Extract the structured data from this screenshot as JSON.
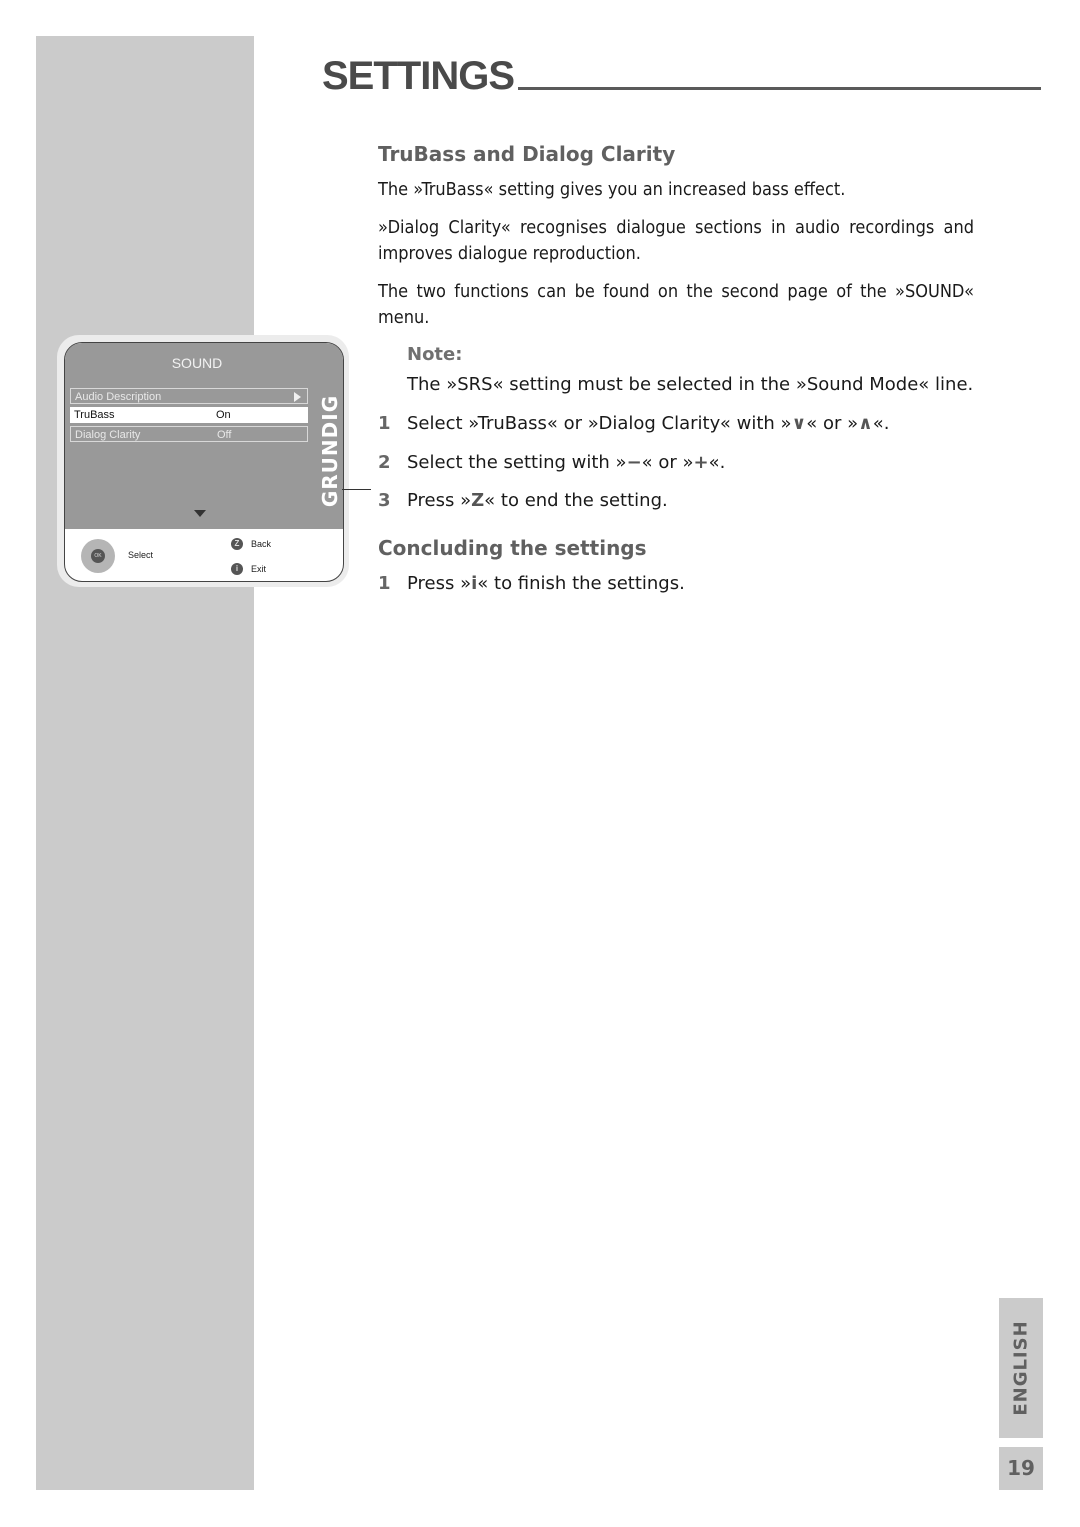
{
  "header": {
    "title": "SETTINGS"
  },
  "section1": {
    "heading": "TruBass and Dialog Clarity",
    "paragraphs": [
      "The »TruBass« setting gives you an increased bass effect.",
      "»Dialog Clarity« recognises dialogue sections in audio recordings and improves dialogue reproduction.",
      "The two functions can be found on the second page of the »SOUND« menu."
    ],
    "note": {
      "label": "Note:",
      "text": "The »SRS« setting must be selected in the »Sound Mode« line."
    },
    "steps": [
      {
        "num": "1",
        "pre": "Select »TruBass« or »Dialog Clarity« with »",
        "key1": "∨",
        "mid": "« or »",
        "key2": "∧",
        "post": "«."
      },
      {
        "num": "2",
        "pre": "Select the setting with »",
        "key1": "−",
        "mid": "« or »",
        "key2": "+",
        "post": "«."
      },
      {
        "num": "3",
        "pre": "Press »",
        "key1": "Z",
        "post": "« to end the setting."
      }
    ]
  },
  "section2": {
    "heading": "Concluding the settings",
    "steps": [
      {
        "num": "1",
        "pre": "Press »",
        "key1": "i",
        "post": "« to finish the settings."
      }
    ]
  },
  "osd_menu": {
    "title": "SOUND",
    "brand": "GRUNDIG",
    "rows": [
      {
        "label": "Audio Description",
        "value": "",
        "has_submenu": true,
        "state": "normal"
      },
      {
        "label": "TruBass",
        "value": "On",
        "has_submenu": false,
        "state": "selected"
      },
      {
        "label": "Dialog Clarity",
        "value": "Off",
        "has_submenu": false,
        "state": "normal"
      }
    ],
    "footer": {
      "ok_label": "OK",
      "select_label": "Select",
      "back_key": "Z",
      "back_label": "Back",
      "exit_key": "i",
      "exit_label": "Exit"
    }
  },
  "language_tab": "ENGLISH",
  "page_number": "19"
}
